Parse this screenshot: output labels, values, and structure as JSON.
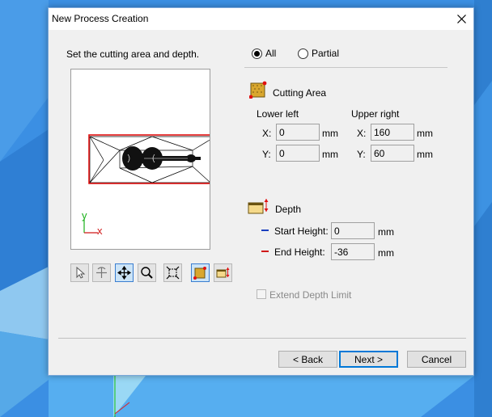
{
  "dialog": {
    "title": "New Process Creation",
    "instruction": "Set the cutting area and depth."
  },
  "area_mode": {
    "options": [
      {
        "label": "All",
        "checked": true
      },
      {
        "label": "Partial",
        "checked": false
      }
    ]
  },
  "cutting_area": {
    "heading": "Cutting Area",
    "lower_left_label": "Lower left",
    "upper_right_label": "Upper right",
    "x_label": "X:",
    "y_label": "Y:",
    "lower_left_x": "0",
    "lower_left_y": "0",
    "upper_right_x": "160",
    "upper_right_y": "60",
    "unit": "mm"
  },
  "depth": {
    "heading": "Depth",
    "start_label": "Start Height:",
    "start_value": "0",
    "end_label": "End Height:",
    "end_value": "-36",
    "unit": "mm",
    "start_color": "#1a3fbf",
    "end_color": "#d01818"
  },
  "extend_depth_limit": {
    "label": "Extend Depth Limit",
    "checked": false,
    "enabled": false
  },
  "preview": {
    "axis_y_label": "y",
    "axis_x_label": "x",
    "axis_y_color": "#1ab01a",
    "axis_x_color": "#d01818",
    "area_outline_color": "#e01010"
  },
  "toolbar": {
    "tools": [
      {
        "name": "select-tool",
        "icon": "pointer-icon",
        "active": false
      },
      {
        "name": "rotate-tool",
        "icon": "rotate-view-icon",
        "active": false
      },
      {
        "name": "pan-tool",
        "icon": "pan-arrows-icon",
        "active": true
      },
      {
        "name": "zoom-tool",
        "icon": "magnifier-icon",
        "active": false
      },
      {
        "name": "fit-tool",
        "icon": "fit-to-window-icon",
        "active": false
      },
      {
        "name": "cutting-area-tool",
        "icon": "cutting-area-icon",
        "active": true
      },
      {
        "name": "depth-tool",
        "icon": "depth-icon",
        "active": false
      }
    ]
  },
  "buttons": {
    "back": "< Back",
    "next": "Next >",
    "cancel": "Cancel"
  }
}
